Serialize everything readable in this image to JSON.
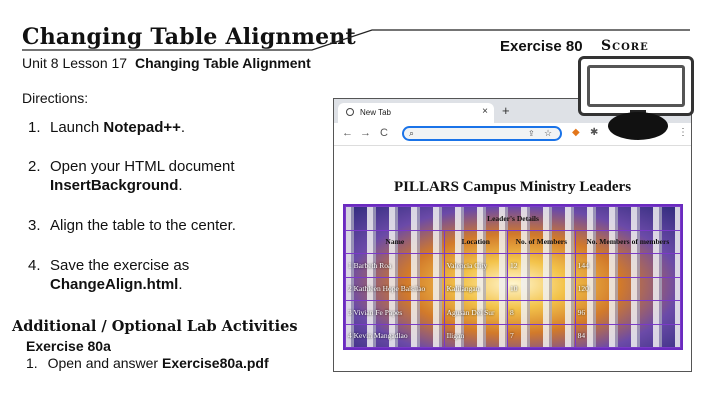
{
  "header": {
    "title": "Changing Table Alignment",
    "exercise": "Exercise 80",
    "score": "Score",
    "subtitle_prefix": "Unit 8 Lesson 17",
    "subtitle_bold": "Changing Table Alignment"
  },
  "directions_label": "Directions:",
  "steps": [
    {
      "num": "1.",
      "pre": "Launch ",
      "bold": "Notepad++",
      "post": "."
    },
    {
      "num": "2.",
      "pre": "Open your HTML document ",
      "bold": "InsertBackground",
      "post": "."
    },
    {
      "num": "3.",
      "pre": "Align the table to the center.",
      "bold": "",
      "post": ""
    },
    {
      "num": "4.",
      "pre": "Save the exercise as ",
      "bold": "ChangeAlign.html",
      "post": "."
    }
  ],
  "additional": {
    "title": "Additional / Optional Lab Activities",
    "exercise": "Exercise 80a",
    "step_num": "1.",
    "step_pre": "Open and answer ",
    "step_bold": "Exercise80a.pdf"
  },
  "browser": {
    "tab_label": "New Tab",
    "tab_close": "×",
    "new_tab": "+",
    "window_controls": "⌄ – ☐ ✕",
    "nav_back": "←",
    "nav_forward": "→",
    "nav_reload": "C",
    "omni_search_icon": "search-icon",
    "page_heading": "PILLARS Campus Ministry Leaders",
    "table": {
      "caption": "Leader's Details",
      "headers": [
        "Name",
        "Location",
        "No. of Members",
        "No. Members of members"
      ],
      "rows": [
        [
          "1 Barbeth Roa",
          "Valencia City",
          "12",
          "144"
        ],
        [
          "2 Kathleen Hope Balsilao",
          "Kalilangan",
          "10",
          "120"
        ],
        [
          "3 Vivian Fe Papes",
          "Agusan Del Sur",
          "8",
          "96"
        ],
        [
          "4 Kevin Mangadlao",
          "Iligan",
          "7",
          "84"
        ]
      ]
    }
  },
  "colors": {
    "table_border": "#6a2bbf",
    "omnibox_focus": "#1a73e8"
  }
}
